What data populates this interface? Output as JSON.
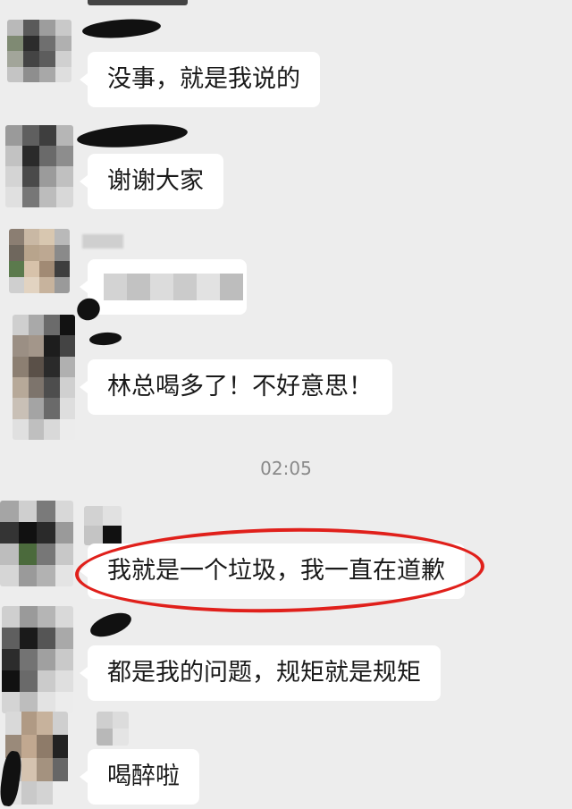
{
  "chat": {
    "messages": [
      {
        "text": "没事，就是我说的"
      },
      {
        "text": "谢谢大家"
      },
      {
        "text": "",
        "obscured": true
      },
      {
        "text": "林总喝多了！不好意思！"
      },
      {
        "text": "我就是一个垃圾，我一直在道歉",
        "highlighted": true
      },
      {
        "text": "都是我的问题，规矩就是规矩"
      },
      {
        "text": "喝醉啦"
      }
    ],
    "timestamp": "02:05"
  },
  "colors": {
    "background": "#ededed",
    "bubble": "#ffffff",
    "highlight": "#e0201b",
    "timestamp": "#8a8a8a"
  },
  "icons": [
    "avatar-pixelated",
    "redaction-scribble"
  ]
}
